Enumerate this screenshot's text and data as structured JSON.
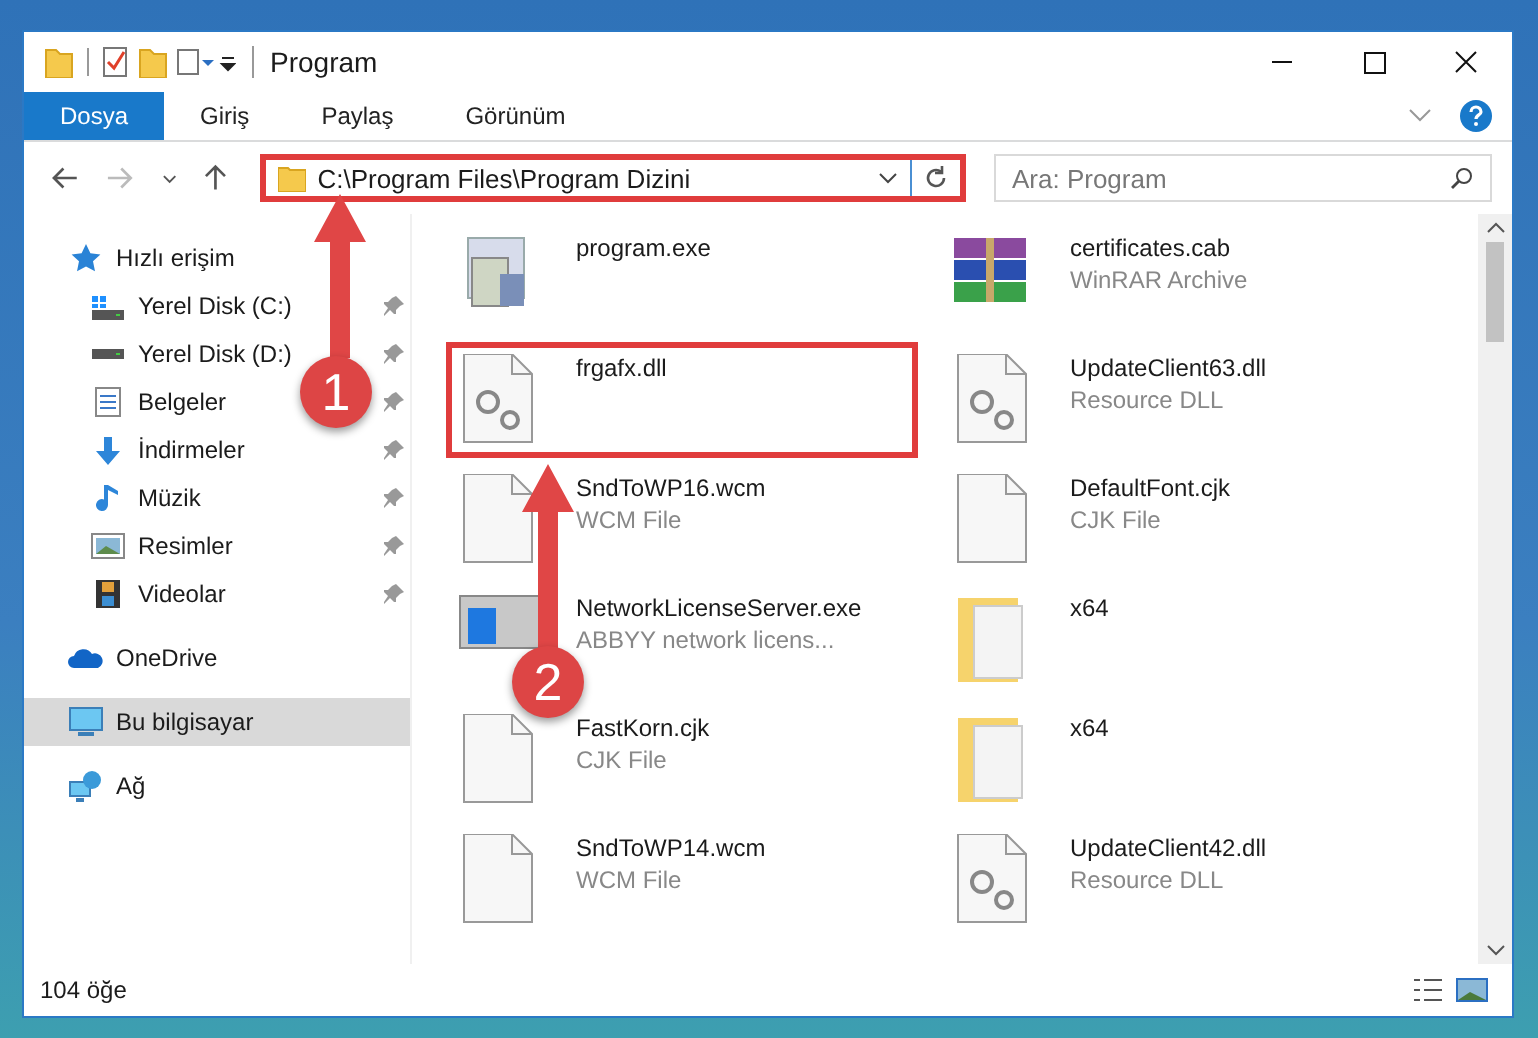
{
  "window": {
    "title": "Program"
  },
  "ribbon_tabs": [
    {
      "label": "Dosya",
      "selected": true
    },
    {
      "label": "Giriş",
      "selected": false
    },
    {
      "label": "Paylaş",
      "selected": false
    },
    {
      "label": "Görünüm",
      "selected": false
    }
  ],
  "address_bar": {
    "path": "C:\\Program Files\\Program Dizini",
    "highlighted": true
  },
  "search": {
    "placeholder": "Ara: Program"
  },
  "sidebar": {
    "items": [
      {
        "label": "Hızlı erişim",
        "selected": false,
        "children": [
          {
            "label": "Yerel Disk (C:)",
            "pinned": true,
            "selected": false
          },
          {
            "label": "Yerel Disk (D:)",
            "pinned": true,
            "selected": false
          },
          {
            "label": "Belgeler",
            "pinned": true,
            "selected": false
          },
          {
            "label": "İndirmeler",
            "pinned": true,
            "selected": false
          },
          {
            "label": "Müzik",
            "pinned": true,
            "selected": false
          },
          {
            "label": "Resimler",
            "pinned": true,
            "selected": false
          },
          {
            "label": "Videolar",
            "pinned": true,
            "selected": false
          }
        ]
      },
      {
        "label": "OneDrive",
        "selected": false
      },
      {
        "label": "Bu bilgisayar",
        "selected": true
      },
      {
        "label": "Ağ",
        "selected": false
      }
    ]
  },
  "files": [
    {
      "name": "program.exe",
      "highlighted": false
    },
    {
      "name": "certificates.cab",
      "type": "WinRAR Archive",
      "highlighted": false
    },
    {
      "name": "frgafx.dll",
      "highlighted": true
    },
    {
      "name": "UpdateClient63.dll",
      "type": "Resource DLL",
      "highlighted": false
    },
    {
      "name": "SndToWP16.wcm",
      "type": "WCM File",
      "highlighted": false
    },
    {
      "name": "DefaultFont.cjk",
      "type": "CJK File",
      "highlighted": false
    },
    {
      "name": "NetworkLicenseServer.exe",
      "type": "ABBYY network licens...",
      "highlighted": false
    },
    {
      "name": "x64",
      "highlighted": false
    },
    {
      "name": "FastKorn.cjk",
      "type": "CJK File",
      "highlighted": false
    },
    {
      "name": "x64",
      "highlighted": false
    },
    {
      "name": "SndToWP14.wcm",
      "type": "WCM File",
      "highlighted": false
    },
    {
      "name": "UpdateClient42.dll",
      "type": "Resource DLL",
      "highlighted": false
    }
  ],
  "status_bar": {
    "item_count": "104 öğe"
  },
  "callouts": [
    {
      "number": "1"
    },
    {
      "number": "2"
    }
  ]
}
